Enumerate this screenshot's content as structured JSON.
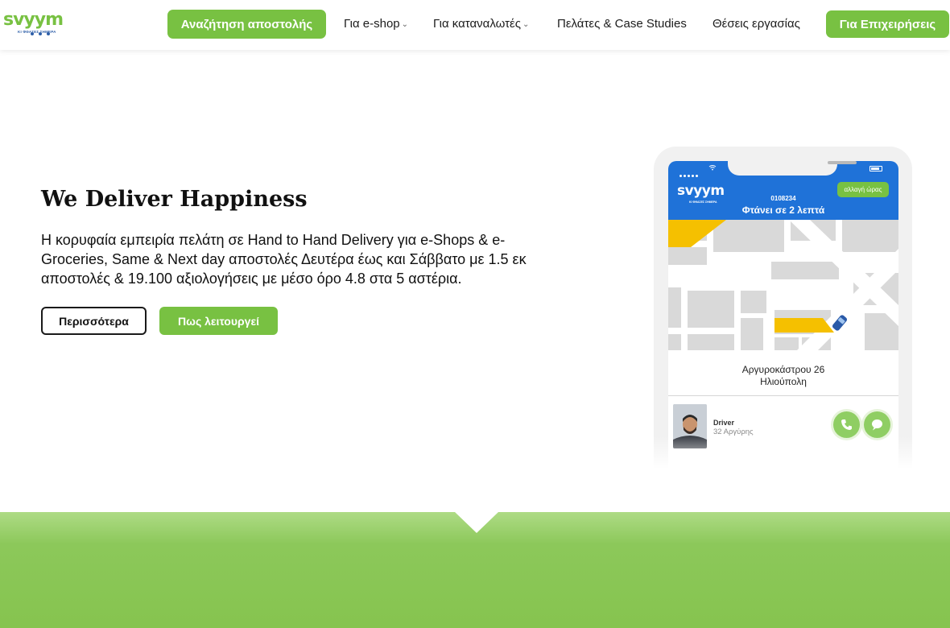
{
  "header": {
    "logo_text": "svyym",
    "logo_tagline": "ΚΙ ΦΘΑΣΕΣ ΣΗΜΕΡΑ",
    "track_button": "Αναζήτηση αποστολής",
    "nav": [
      {
        "label": "Για e-shop",
        "dropdown": true
      },
      {
        "label": "Για καταναλωτές",
        "dropdown": true
      },
      {
        "label": "Πελάτες & Case Studies",
        "dropdown": false
      },
      {
        "label": "Θέσεις εργασίας",
        "dropdown": false
      }
    ],
    "business_button": "Για Επιχειρήσεις"
  },
  "hero": {
    "title": "We Deliver Happiness",
    "description": "Η κορυφαία εμπειρία πελάτη σε Hand to Hand Delivery για e-Shops & e-Groceries, Same & Next day αποστολές Δευτέρα έως και Σάββατο με 1.5 εκ αποστολές & 19.100 αξιολογήσεις με μέσο όρο 4.8 στα 5 αστέρια.",
    "more_button": "Περισσότερα",
    "how_button": "Πως λειτουργεί"
  },
  "phone_app": {
    "logo_text": "svyym",
    "logo_tagline": "ΚΙ ΦΘΑΣΕΣ ΣΗΜΕΡΑ",
    "change_time_button": "αλλαγή ώρας",
    "order_number": "0108234",
    "eta": "Φτάνει σε 2 λεπτά",
    "address_line1": "Αργυροκάστρου 26",
    "address_line2": "Ηλιούπολη",
    "driver_label": "Driver",
    "driver_name": "32 Αργύρης"
  },
  "colors": {
    "brand_green": "#78c142",
    "brand_blue": "#1f72d8",
    "map_yellow": "#f5c000",
    "map_gray": "#d9d9d9"
  },
  "icons": [
    "chevron-down-icon",
    "phone-icon",
    "chat-bubble-icon",
    "wifi-icon",
    "battery-icon",
    "signal-icon",
    "car-icon"
  ]
}
